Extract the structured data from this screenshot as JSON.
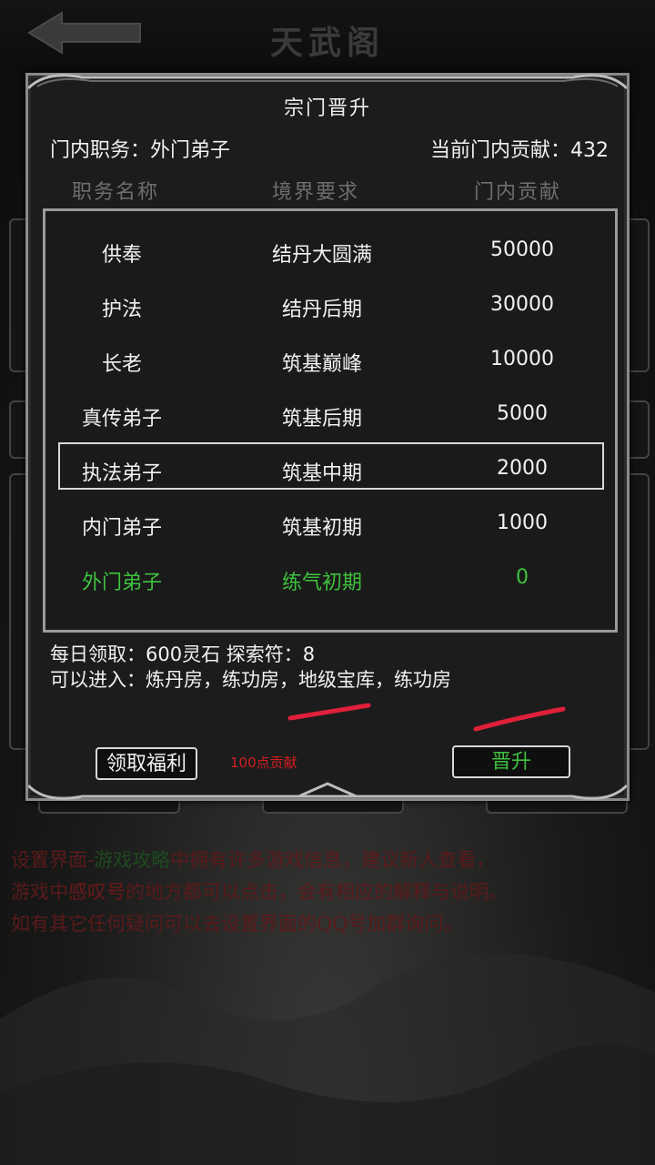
{
  "header": {
    "title": "天武阁",
    "back_icon": "back-arrow-icon"
  },
  "dialog": {
    "title": "宗门晋升",
    "position_label": "门内职务：外门弟子",
    "contribution_label": "当前门内贡献：432",
    "columns": [
      "职务名称",
      "境界要求",
      "门内贡献"
    ],
    "rows": [
      {
        "name": "供奉",
        "realm": "结丹大圆满",
        "contribution": "50000"
      },
      {
        "name": "护法",
        "realm": "结丹后期",
        "contribution": "30000"
      },
      {
        "name": "长老",
        "realm": "筑基巅峰",
        "contribution": "10000"
      },
      {
        "name": "真传弟子",
        "realm": "筑基后期",
        "contribution": "5000"
      },
      {
        "name": "执法弟子",
        "realm": "筑基中期",
        "contribution": "2000"
      },
      {
        "name": "内门弟子",
        "realm": "筑基初期",
        "contribution": "1000"
      },
      {
        "name": "外门弟子",
        "realm": "练气初期",
        "contribution": "0"
      }
    ],
    "daily_reward": "每日领取：600灵石 探索符：8",
    "access": "可以进入：炼丹房，练功房，地级宝库，练功房",
    "claim_button": "领取福利",
    "cost_text": "100点贡献",
    "promote_button": "晋升",
    "colors": {
      "current_rank": "#3ec23e",
      "cost": "#d21e1e",
      "mark": "#e0203a"
    }
  },
  "notice": {
    "line1_a": "设置界面-",
    "line1_b": "游戏攻略",
    "line1_c": "中拥有许多游戏信息，建议新人查看，",
    "line2_a": "游戏中",
    "line2_b": "感叹号",
    "line2_c": "的地方都可以点击，会有相应的解释与说明。",
    "line3": "如有其它任何疑问可以去设置界面的QQ号加群询问。"
  }
}
